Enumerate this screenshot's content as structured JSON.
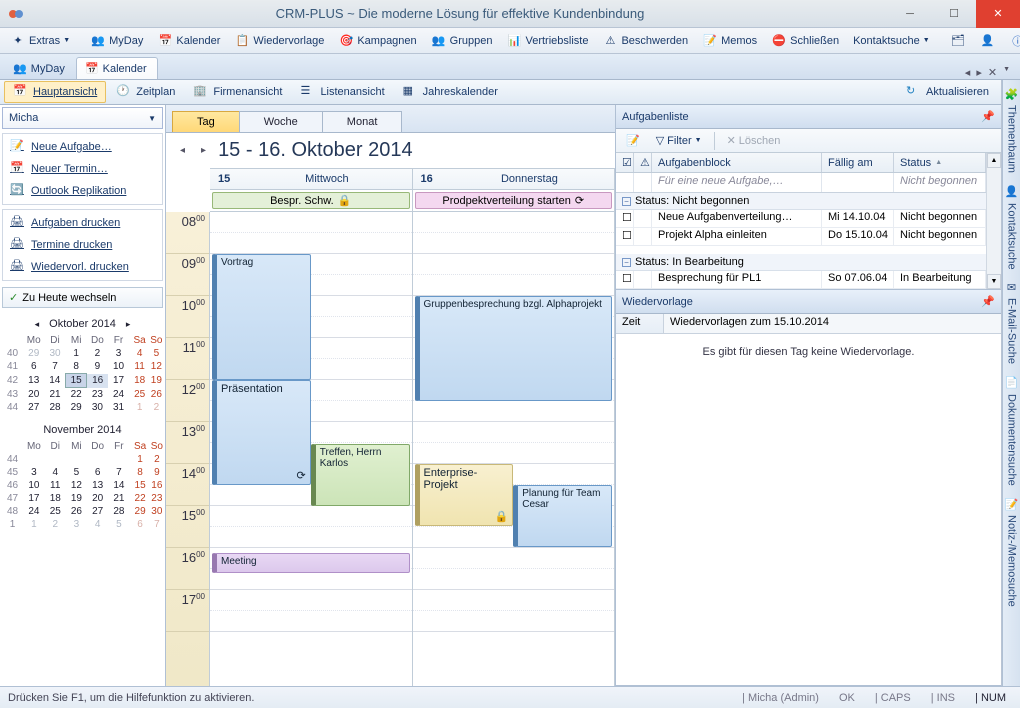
{
  "window": {
    "title": "CRM-PLUS ~ Die moderne Lösung für effektive Kundenbindung"
  },
  "toolbar": {
    "extras": "Extras",
    "myday": "MyDay",
    "kalender": "Kalender",
    "wiedervorlage": "Wiedervorlage",
    "kampagnen": "Kampagnen",
    "gruppen": "Gruppen",
    "vertriebsliste": "Vertriebsliste",
    "beschwerden": "Beschwerden",
    "memos": "Memos",
    "schliessen": "Schließen",
    "kontaktsuche": "Kontaktsuche"
  },
  "tabs": {
    "myday": "MyDay",
    "kalender": "Kalender"
  },
  "viewbar": {
    "hauptansicht": "Hauptansicht",
    "zeitplan": "Zeitplan",
    "firmenansicht": "Firmenansicht",
    "listenansicht": "Listenansicht",
    "jahreskalender": "Jahreskalender",
    "aktualisieren": "Aktualisieren"
  },
  "user": {
    "name": "Micha"
  },
  "sidebar": {
    "neue_aufgabe": "Neue Aufgabe…",
    "neuer_termin": "Neuer Termin…",
    "outlook": "Outlook Replikation",
    "aufgaben_drucken": "Aufgaben drucken",
    "termine_drucken": "Termine drucken",
    "wiedervorl_drucken": "Wiedervorl. drucken",
    "zu_heute": "Zu Heute wechseln"
  },
  "minical1": {
    "title": "Oktober 2014",
    "dow": [
      "Mo",
      "Di",
      "Mi",
      "Do",
      "Fr",
      "Sa",
      "So"
    ],
    "weeks": [
      {
        "wk": "40",
        "d": [
          {
            "n": "29",
            "c": "off"
          },
          {
            "n": "30",
            "c": "off"
          },
          {
            "n": "1"
          },
          {
            "n": "2"
          },
          {
            "n": "3"
          },
          {
            "n": "4",
            "c": "sat"
          },
          {
            "n": "5",
            "c": "sun"
          }
        ]
      },
      {
        "wk": "41",
        "d": [
          {
            "n": "6"
          },
          {
            "n": "7"
          },
          {
            "n": "8"
          },
          {
            "n": "9"
          },
          {
            "n": "10"
          },
          {
            "n": "11",
            "c": "sat"
          },
          {
            "n": "12",
            "c": "sun"
          }
        ]
      },
      {
        "wk": "42",
        "d": [
          {
            "n": "13"
          },
          {
            "n": "14"
          },
          {
            "n": "15",
            "c": "today"
          },
          {
            "n": "16",
            "c": "sel"
          },
          {
            "n": "17"
          },
          {
            "n": "18",
            "c": "sat"
          },
          {
            "n": "19",
            "c": "sun"
          }
        ]
      },
      {
        "wk": "43",
        "d": [
          {
            "n": "20"
          },
          {
            "n": "21"
          },
          {
            "n": "22"
          },
          {
            "n": "23"
          },
          {
            "n": "24"
          },
          {
            "n": "25",
            "c": "sat"
          },
          {
            "n": "26",
            "c": "sun"
          }
        ]
      },
      {
        "wk": "44",
        "d": [
          {
            "n": "27"
          },
          {
            "n": "28"
          },
          {
            "n": "29"
          },
          {
            "n": "30"
          },
          {
            "n": "31"
          },
          {
            "n": "1",
            "c": "off sat"
          },
          {
            "n": "2",
            "c": "off sun"
          }
        ]
      }
    ]
  },
  "minical2": {
    "title": "November 2014",
    "dow": [
      "Mo",
      "Di",
      "Mi",
      "Do",
      "Fr",
      "Sa",
      "So"
    ],
    "weeks": [
      {
        "wk": "44",
        "d": [
          {
            "n": "",
            "c": "off"
          },
          {
            "n": "",
            "c": "off"
          },
          {
            "n": "",
            "c": "off"
          },
          {
            "n": "",
            "c": "off"
          },
          {
            "n": "",
            "c": "off"
          },
          {
            "n": "1",
            "c": "sat"
          },
          {
            "n": "2",
            "c": "sun"
          }
        ]
      },
      {
        "wk": "45",
        "d": [
          {
            "n": "3"
          },
          {
            "n": "4"
          },
          {
            "n": "5"
          },
          {
            "n": "6"
          },
          {
            "n": "7"
          },
          {
            "n": "8",
            "c": "sat"
          },
          {
            "n": "9",
            "c": "sun"
          }
        ]
      },
      {
        "wk": "46",
        "d": [
          {
            "n": "10"
          },
          {
            "n": "11"
          },
          {
            "n": "12"
          },
          {
            "n": "13"
          },
          {
            "n": "14"
          },
          {
            "n": "15",
            "c": "sat"
          },
          {
            "n": "16",
            "c": "sun"
          }
        ]
      },
      {
        "wk": "47",
        "d": [
          {
            "n": "17"
          },
          {
            "n": "18"
          },
          {
            "n": "19"
          },
          {
            "n": "20"
          },
          {
            "n": "21"
          },
          {
            "n": "22",
            "c": "sat"
          },
          {
            "n": "23",
            "c": "sun"
          }
        ]
      },
      {
        "wk": "48",
        "d": [
          {
            "n": "24"
          },
          {
            "n": "25"
          },
          {
            "n": "26"
          },
          {
            "n": "27"
          },
          {
            "n": "28"
          },
          {
            "n": "29",
            "c": "sat"
          },
          {
            "n": "30",
            "c": "sun"
          }
        ]
      },
      {
        "wk": "1",
        "d": [
          {
            "n": "1",
            "c": "off"
          },
          {
            "n": "2",
            "c": "off"
          },
          {
            "n": "3",
            "c": "off"
          },
          {
            "n": "4",
            "c": "off"
          },
          {
            "n": "5",
            "c": "off"
          },
          {
            "n": "6",
            "c": "off sat"
          },
          {
            "n": "7",
            "c": "off sun"
          }
        ]
      }
    ]
  },
  "cal": {
    "tab_tag": "Tag",
    "tab_woche": "Woche",
    "tab_monat": "Monat",
    "title": "15 - 16. Oktober 2014",
    "day1_num": "15",
    "day1_name": "Mittwoch",
    "day2_num": "16",
    "day2_name": "Donnerstag",
    "allday1": "Bespr. Schw.",
    "allday2": "Prodpektverteilung starten",
    "hours": [
      "08",
      "09",
      "10",
      "11",
      "12",
      "13",
      "14",
      "15",
      "16",
      "17"
    ],
    "min": "00",
    "evt_vortrag": "Vortrag",
    "evt_praesentation": "Präsentation",
    "evt_treffen": "Treffen, Herrn Karlos",
    "evt_meeting": "Meeting",
    "evt_gruppen": "Gruppenbesprechung bzgl. Alphaprojekt",
    "evt_enterprise": "Enterprise-Projekt",
    "evt_planung": "Planung für Team Cesar"
  },
  "tasks": {
    "title": "Aufgabenliste",
    "filter": "Filter",
    "loeschen": "Löschen",
    "col_block": "Aufgabenblock",
    "col_faellig": "Fällig am",
    "col_status": "Status",
    "placeholder": "Für eine neue Aufgabe,…",
    "new_status": "Nicht begonnen",
    "grp1": "Status: Nicht begonnen",
    "grp2": "Status: In Bearbeitung",
    "rows": [
      {
        "t": "Neue Aufgabenverteilung…",
        "d": "Mi 14.10.04",
        "s": "Nicht begonnen"
      },
      {
        "t": "Projekt Alpha einleiten",
        "d": "Do 15.10.04",
        "s": "Nicht begonnen"
      }
    ],
    "rows2": [
      {
        "t": "Besprechung für PL1",
        "d": "So 07.06.04",
        "s": "In Bearbeitung"
      }
    ]
  },
  "wv": {
    "title": "Wiedervorlage",
    "zeit_label": "Zeit",
    "zeit_value": "Wiedervorlagen zum 15.10.2014",
    "empty": "Es gibt für diesen Tag keine Wiedervorlage."
  },
  "rightstrip": {
    "themenbaum": "Themenbaum",
    "kontaktsuche": "Kontaktsuche",
    "emailsuche": "E-Mail-Suche",
    "dokumentensuche": "Dokumentensuche",
    "notizmemo": "Notiz-/Memosuche"
  },
  "status": {
    "help": "Drücken Sie F1, um die Hilfefunktion zu aktivieren.",
    "user": "Micha (Admin)",
    "ok": "OK",
    "caps": "CAPS",
    "ins": "INS",
    "num": "NUM"
  }
}
